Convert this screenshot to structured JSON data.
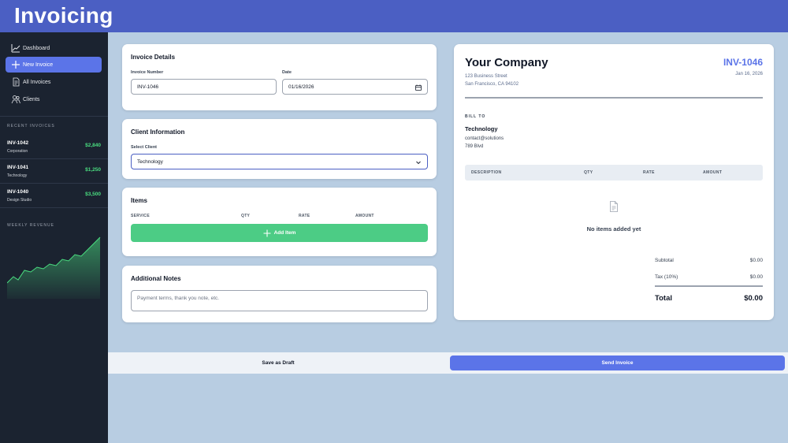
{
  "app": {
    "title": "Invoicing"
  },
  "sidebar": {
    "nav": [
      {
        "label": "Dashboard",
        "icon": "chart-icon"
      },
      {
        "label": "New Invoice",
        "icon": "plus-icon",
        "active": true
      },
      {
        "label": "All Invoices",
        "icon": "document-icon"
      },
      {
        "label": "Clients",
        "icon": "users-icon"
      }
    ],
    "recent_label": "RECENT INVOICES",
    "recent": [
      {
        "id": "INV-1042",
        "client": "Corporation",
        "amount": "$2,840"
      },
      {
        "id": "INV-1041",
        "client": "Technology",
        "amount": "$1,250"
      },
      {
        "id": "INV-1040",
        "client": "Design Studio",
        "amount": "$3,500"
      }
    ],
    "revenue_label": "WEEKLY REVENUE"
  },
  "details": {
    "title": "Invoice Details",
    "number_label": "Invoice Number",
    "number_value": "INV-1046",
    "date_label": "Date",
    "date_value": "01/16/2026"
  },
  "client_info": {
    "title": "Client Information",
    "select_label": "Select Client",
    "selected": "Technology"
  },
  "items": {
    "title": "Items",
    "columns": [
      "SERVICE",
      "QTY",
      "RATE",
      "AMOUNT"
    ],
    "add_label": "Add Item"
  },
  "notes": {
    "title": "Additional Notes",
    "placeholder": "Payment terms, thank you note, etc."
  },
  "preview": {
    "company": "Your Company",
    "address_line1": "123 Business Street",
    "address_line2": "San Francisco, CA 94102",
    "invoice_number": "INV-1046",
    "invoice_date": "Jan 16, 2026",
    "bill_to_label": "BILL TO",
    "client_name": "Technology",
    "client_email": "contact@solutions",
    "client_address": "789 Blvd",
    "columns": [
      "DESCRIPTION",
      "QTY",
      "RATE",
      "AMOUNT"
    ],
    "empty_text": "No items added yet",
    "subtotal_label": "Subtotal",
    "subtotal_value": "$0.00",
    "tax_label": "Tax (10%)",
    "tax_value": "$0.00",
    "total_label": "Total",
    "total_value": "$0.00"
  },
  "actions": {
    "draft": "Save as Draft",
    "send": "Send Invoice"
  },
  "colors": {
    "topbar": "#4b5fc3",
    "sidebar": "#1b2330",
    "accent": "#5b74e8",
    "add_button": "#4ccc85",
    "positive_amount": "#4ade80"
  }
}
